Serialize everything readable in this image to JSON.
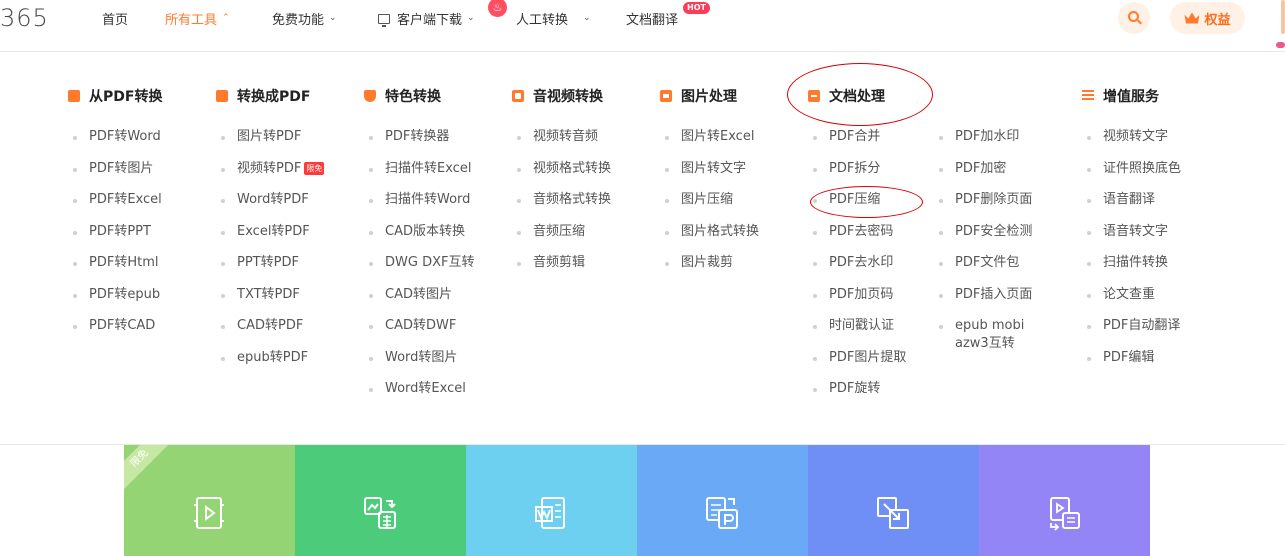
{
  "header": {
    "logo": "365",
    "nav": [
      {
        "label": "首页"
      },
      {
        "label": "所有工具",
        "active": true
      },
      {
        "label": "免费功能"
      },
      {
        "label": "客户端下载"
      },
      {
        "label": "人工转换"
      },
      {
        "label": "文档翻译",
        "badge": "HOT"
      }
    ],
    "vip_label": "权益",
    "search_icon": "search-icon",
    "accent_color": "#ff7a2c"
  },
  "menu": {
    "columns": [
      {
        "title": "从PDF转换",
        "items": [
          "PDF转Word",
          "PDF转图片",
          "PDF转Excel",
          "PDF转PPT",
          "PDF转Html",
          "PDF转epub",
          "PDF转CAD"
        ]
      },
      {
        "title": "转换成PDF",
        "items": [
          "图片转PDF",
          "视频转PDF",
          "Word转PDF",
          "Excel转PDF",
          "PPT转PDF",
          "TXT转PDF",
          "CAD转PDF",
          "epub转PDF"
        ],
        "badge": "限免"
      },
      {
        "title": "特色转换",
        "items": [
          "PDF转换器",
          "扫描件转Excel",
          "扫描件转Word",
          "CAD版本转换",
          "DWG DXF互转",
          "CAD转图片",
          "CAD转DWF",
          "Word转图片",
          "Word转Excel"
        ]
      },
      {
        "title": "音视频转换",
        "items": [
          "视频转音频",
          "视频格式转换",
          "音频格式转换",
          "音频压缩",
          "音频剪辑"
        ]
      },
      {
        "title": "图片处理",
        "items": [
          "图片转Excel",
          "图片转文字",
          "图片压缩",
          "图片格式转换",
          "图片裁剪"
        ]
      },
      {
        "title": "文档处理",
        "items": [
          "PDF合并",
          "PDF拆分",
          "PDF压缩",
          "PDF去密码",
          "PDF去水印",
          "PDF加页码",
          "时间戳认证",
          "PDF图片提取",
          "PDF旋转"
        ],
        "items_b": [
          "PDF加水印",
          "PDF加密",
          "PDF删除页面",
          "PDF安全检测",
          "PDF文件包",
          "PDF插入页面",
          "epub mobi azw3互转"
        ]
      },
      {
        "title": "增值服务",
        "items": [
          "视频转文字",
          "证件照换底色",
          "语音翻译",
          "语音转文字",
          "扫描件转换",
          "论文查重",
          "PDF自动翻译",
          "PDF编辑"
        ]
      }
    ]
  },
  "tiles": [
    {
      "color": "#95d475",
      "icon": "video-pdf-icon",
      "corner": "限免"
    },
    {
      "color": "#4ccb7a",
      "icon": "image-table-icon"
    },
    {
      "color": "#6dd0f0",
      "icon": "word-icon"
    },
    {
      "color": "#6aa9f5",
      "icon": "file-convert-p-icon"
    },
    {
      "color": "#6f8ff7",
      "icon": "crop-icon"
    },
    {
      "color": "#9485f6",
      "icon": "file-export-icon"
    }
  ]
}
